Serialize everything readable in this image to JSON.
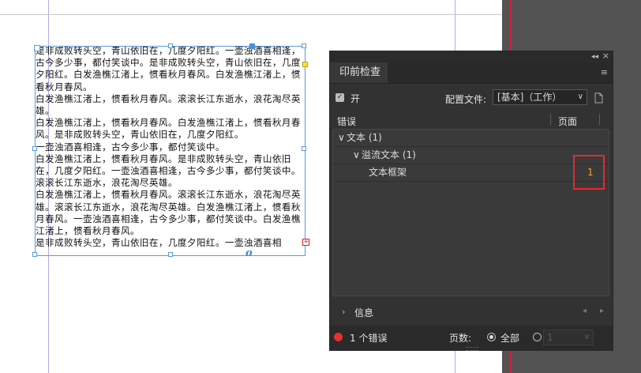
{
  "document": {
    "paragraphs": [
      "是非成败转头空，青山依旧在，几度夕阳红。一壶浊酒喜相逢，古今多少事，都付笑谈中。是非成败转头空，青山依旧在，几度夕阳红。白发渔樵江渚上，惯看秋月春风。白发渔樵江渚上，惯看秋月春风。",
      "白发渔樵江渚上，惯看秋月春风。滚滚长江东逝水，浪花淘尽英雄。",
      "白发渔樵江渚上，惯看秋月春风。白发渔樵江渚上，惯看秋月春风。是非成败转头空，青山依旧在，几度夕阳红。",
      "一壶浊酒喜相逢，古今多少事，都付笑谈中。",
      "白发渔樵江渚上，惯看秋月春风。是非成败转头空，青山依旧在，几度夕阳红。一壶浊酒喜相逢，古今多少事，都付笑谈中。滚滚长江东逝水，浪花淘尽英雄。",
      "白发渔樵江渚上，惯看秋月春风。滚滚长江东逝水，浪花淘尽英雄。滚滚长江东逝水，浪花淘尽英雄。白发渔樵江渚上，惯看秋月春风。一壶浊酒喜相逢，古今多少事，都付笑谈中。白发渔樵江渚上，惯看秋月春风。",
      "是非成败转头空，青山依旧在，几度夕阳红。一壶浊酒喜相"
    ],
    "overset_marker": "+",
    "anchor_symbol": "o"
  },
  "panel": {
    "collapse_label": "◂◂",
    "close_label": "×",
    "tab_title": "印前检查",
    "menu_icon": "≡",
    "on_label": "开",
    "checkbox_mark": "✓",
    "profile_label": "配置文件:",
    "profile_value": "[基本]（工作）",
    "profile_icon": "profile-define-icon",
    "column_error": "错误",
    "column_page": "页面",
    "tree": [
      {
        "expander": "∨",
        "label": "文本 (1)",
        "page": ""
      },
      {
        "expander": "∨",
        "label": "溢流文本 (1)",
        "page": ""
      },
      {
        "expander": "",
        "label": "文本框架",
        "page": "1"
      }
    ],
    "info_label": "信息",
    "info_expander": "›",
    "info_prev": "◂",
    "info_next": "▸",
    "status_text": "1 个错误",
    "status_color": "#e8302e",
    "pages_label": "页数:",
    "all_label": "全部",
    "page_range_value": "1",
    "dropdown_chevron": "∨"
  },
  "colors": {
    "accent_error": "#e8282e",
    "page_number": "#f2a62b",
    "frame_border": "#5b9bd6"
  }
}
